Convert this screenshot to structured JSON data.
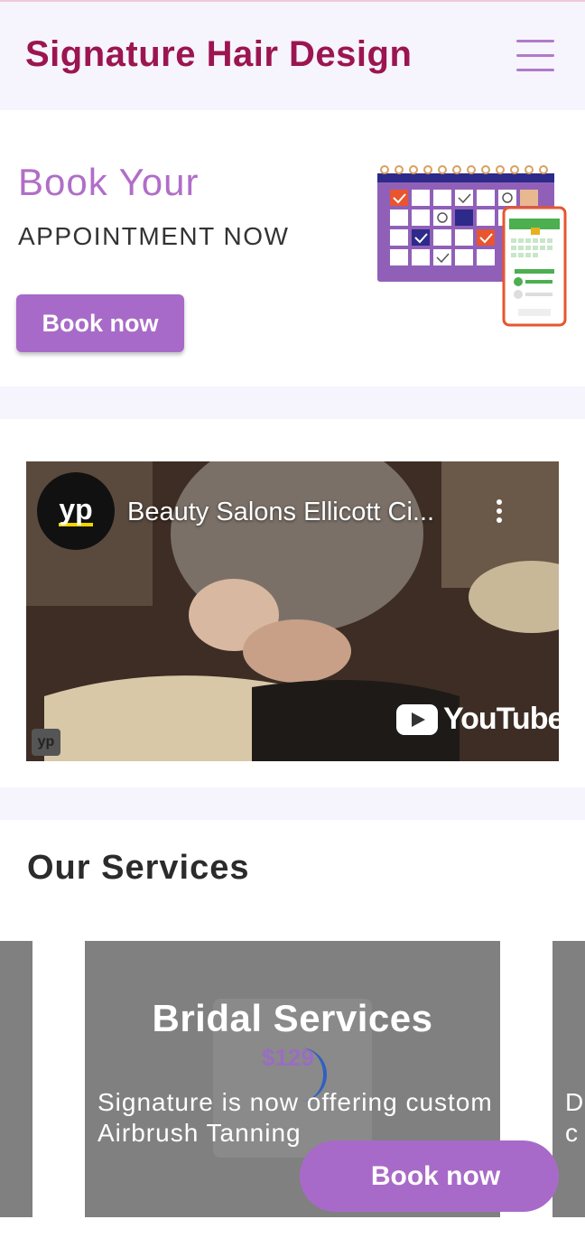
{
  "header": {
    "brand": "Signature Hair Design",
    "menu_icon": "hamburger-menu-icon"
  },
  "hero": {
    "title": "Book Your",
    "subtitle": "APPOINTMENT NOW",
    "button_label": "Book now",
    "illustration": "calendar-booking-illustration"
  },
  "video": {
    "channel_logo": "yp",
    "title": "Beauty Salons Ellicott Ci...",
    "platform_label": "YouTube",
    "watermark": "yp"
  },
  "services": {
    "heading": "Our Services",
    "cards": [
      {
        "title": "Bridal Services",
        "price": "$129",
        "description": "Signature is now offering custom Airbrush Tanning"
      }
    ],
    "next_card_peek": [
      "D",
      "c"
    ]
  },
  "floating_button": {
    "label": "Book now"
  },
  "colors": {
    "brand": "#9b1550",
    "accent": "#a86ac8",
    "header_bg": "#f6f4fd",
    "card_bg": "#808080"
  }
}
